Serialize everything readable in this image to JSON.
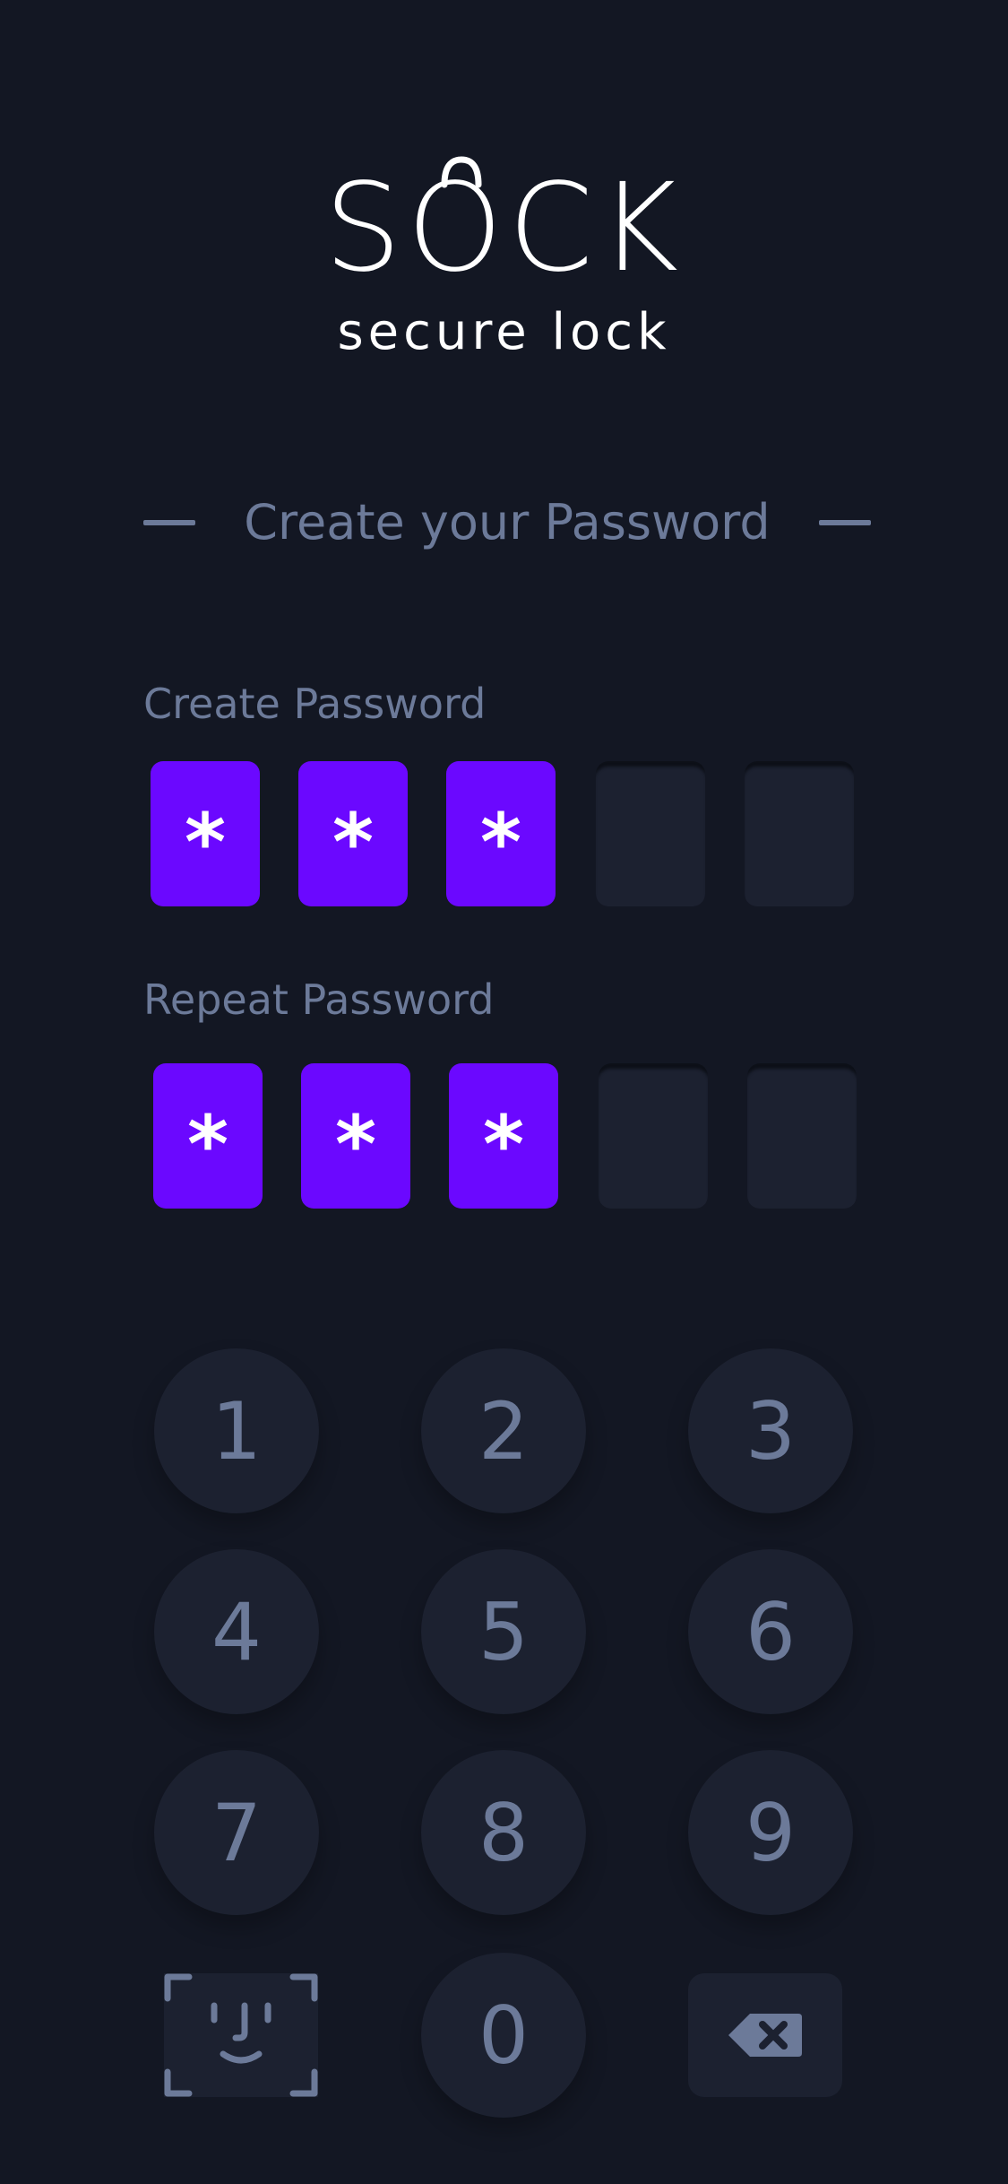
{
  "logo": {
    "title": "SOCK",
    "subtitle": "secure lock"
  },
  "heading": "Create your Password",
  "create_password": {
    "label": "Create Password",
    "boxes": [
      "*",
      "*",
      "*",
      "",
      ""
    ]
  },
  "repeat_password": {
    "label": "Repeat Password",
    "boxes": [
      "*",
      "*",
      "*",
      "",
      ""
    ]
  },
  "keypad": {
    "keys": [
      "1",
      "2",
      "3",
      "4",
      "5",
      "6",
      "7",
      "8",
      "9",
      "0"
    ],
    "left_action_icon": "face-id-icon",
    "right_action_icon": "backspace-icon"
  },
  "colors": {
    "background": "#131723",
    "accent": "#6b08ff",
    "muted_text": "#6c7a99",
    "surface": "#1c2130"
  }
}
